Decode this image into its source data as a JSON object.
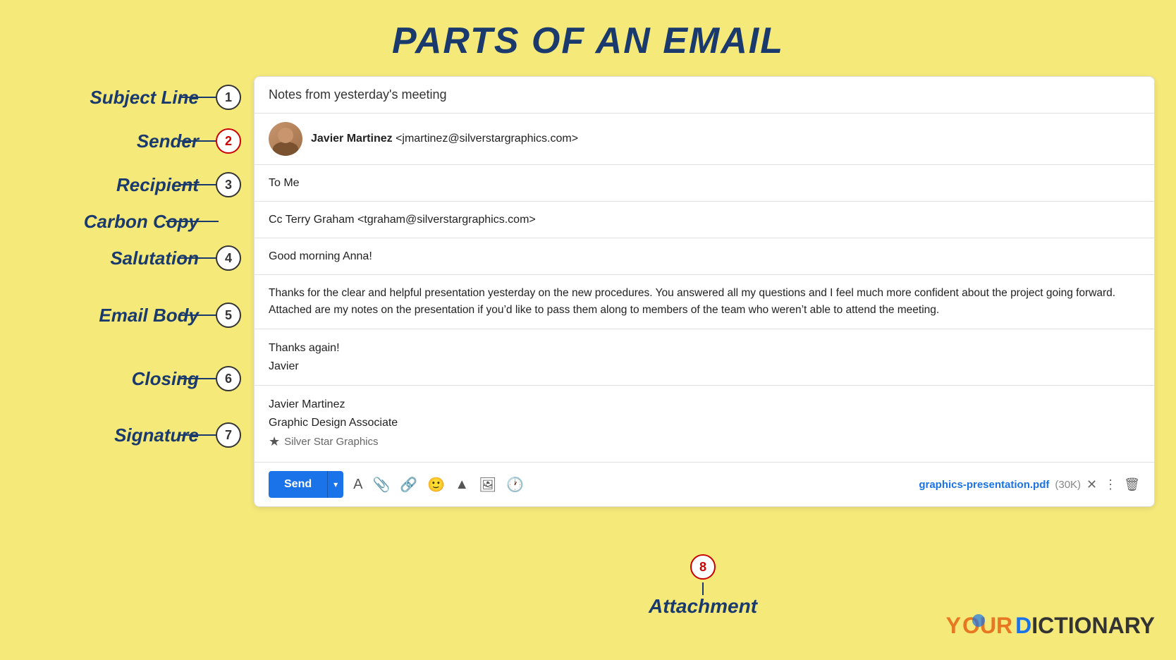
{
  "page": {
    "title": "PARTS OF AN EMAIL",
    "background_color": "#f5e97a"
  },
  "labels": {
    "subject_line": "Subject Line",
    "sender": "Sender",
    "recipient": "Recipient",
    "carbon_copy": "Carbon Copy",
    "salutation": "Salutation",
    "email_body": "Email Body",
    "closing": "Closing",
    "signature": "Signature",
    "attachment": "Attachment"
  },
  "email": {
    "subject": "Notes from yesterday's meeting",
    "sender_name": "Javier Martinez",
    "sender_email": "<jmartinez@silverstargraphics.com>",
    "recipient": "To Me",
    "cc": "Cc Terry Graham <tgraham@silverstargraphics.com>",
    "salutation": "Good morning Anna!",
    "body": "Thanks for the clear and helpful presentation yesterday on the new procedures. You answered all my questions and I feel much more confident about the project going forward. Attached are my notes on the presentation if you’d like to pass them along to members of the team who weren’t able to attend the meeting.",
    "closing_line1": "Thanks again!",
    "closing_line2": "Javier",
    "sig_name": "Javier Martinez",
    "sig_title": "Graphic Design Associate",
    "sig_company": "Silver Star Graphics",
    "attachment_name": "graphics-presentation.pdf",
    "attachment_size": "(30K)"
  },
  "toolbar": {
    "send_label": "Send",
    "dropdown_arrow": "▾"
  },
  "numbers": {
    "n1": "1",
    "n2": "2",
    "n3": "3",
    "n4": "4",
    "n5": "5",
    "n6": "6",
    "n7": "7",
    "n8": "8"
  },
  "logo": {
    "your": "Y",
    "our": "OUR",
    "d": "D",
    "ictionary": "ICTIONARY"
  }
}
